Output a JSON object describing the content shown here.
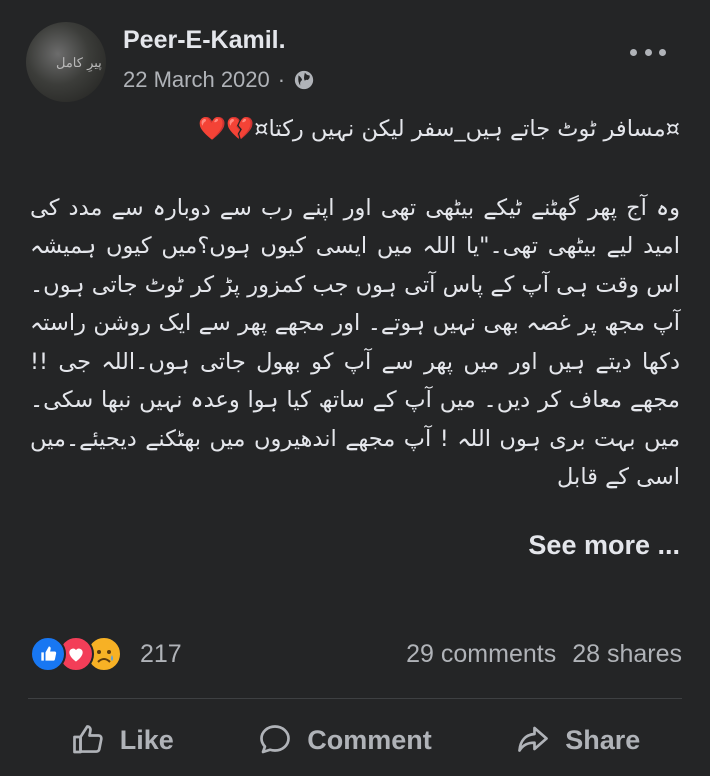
{
  "post": {
    "author": "Peer-E-Kamil.",
    "avatar_text": "پیرِ کامل",
    "date": "22 March 2020",
    "separator": "·",
    "audience_icon": "globe-icon",
    "title": "¤مسافر ٹوٹ جاتے ہیں_سفر لیکن نہیں رکتا¤💔❤️",
    "body": "وہ آج پھر گھٹنے ٹیکے بیٹھی تھی اور اپنے رب سے دوبارہ سے مدد کی امید لیے بیٹھی تھی۔\"یا اللہ میں ایسی کیوں ہوں؟میں کیوں ہمیشہ اس وقت ہی آپ کے پاس آتی ہوں جب کمزور پڑ کر ٹوٹ جاتی ہوں۔آپ مجھ پر غصہ بھی نہیں ہوتے۔ اور مجھے پھر سے ایک روشن راستہ دکھا دیتے ہیں اور میں پھر سے آپ کو بھول جاتی ہوں۔اللہ جی !! مجھے معاف کر دیں۔ میں آپ کے ساتھ کیا ہوا وعدہ نہیں نبھا سکی۔ میں بہت بری ہوں اللہ ! آپ مجھے اندھیروں میں بھٹکنے دیجیئے۔میں اسی کے قابل",
    "see_more": "See more ..."
  },
  "reactions": {
    "icons": [
      "like-icon",
      "love-icon",
      "sad-icon"
    ],
    "count": "217",
    "comments": "29 comments",
    "shares": "28 shares"
  },
  "actions": {
    "like": "Like",
    "comment": "Comment",
    "share": "Share"
  },
  "colors": {
    "background": "#242526",
    "text_primary": "#e4e6eb",
    "text_secondary": "#b0b3b8",
    "like_blue": "#1877f2",
    "love_red": "#f33e58",
    "sad_yellow": "#f7b125"
  }
}
